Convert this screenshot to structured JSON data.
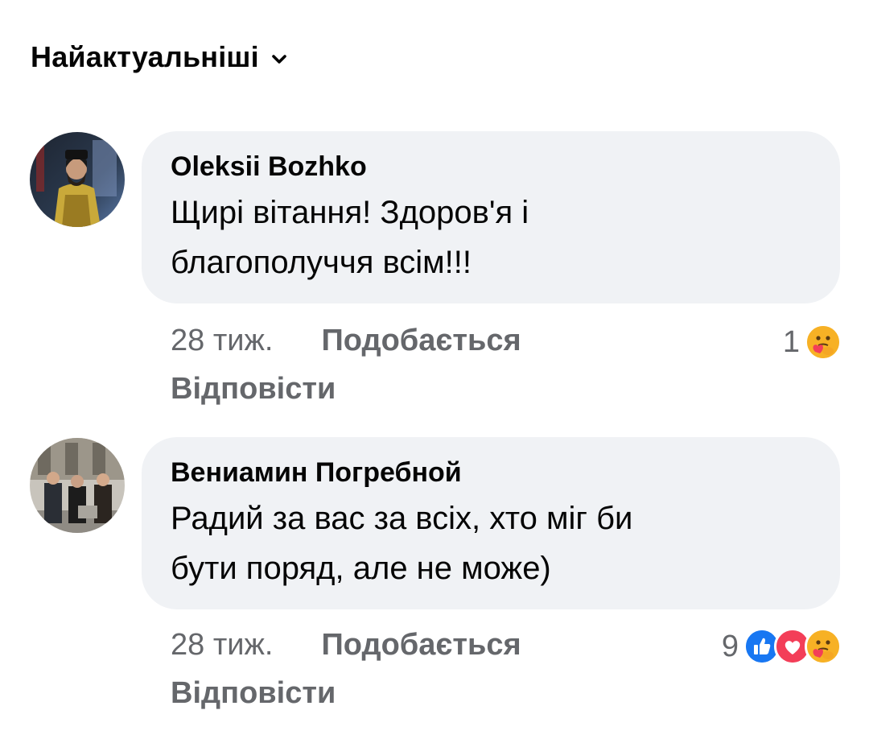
{
  "sort": {
    "label": "Найактуальніші",
    "icon": "chevron-down-icon"
  },
  "comments": [
    {
      "author": "Oleksii Bozhko",
      "text_line1": "Щирі вітання! Здоров'я і",
      "text_line2": "благополуччя всім!!!",
      "time": "28 тиж.",
      "like_label": "Подобається",
      "reply_label": "Відповісти",
      "reaction_count": "1",
      "reactions": [
        "care-icon"
      ]
    },
    {
      "author": "Вениамин Погребной",
      "text_line1": "Радий за вас за всіх, хто міг би",
      "text_line2": "бути поряд, але не може)",
      "time": "28 тиж.",
      "like_label": "Подобається",
      "reply_label": "Відповісти",
      "reaction_count": "9",
      "reactions": [
        "like-icon",
        "love-icon",
        "care-icon"
      ]
    }
  ],
  "colors": {
    "bubble": "#f0f2f5",
    "meta_text": "#65676b",
    "primary_text": "#050505",
    "like_blue": "#1877f2",
    "love_red": "#f33e58",
    "care_yellow": "#f7b125"
  }
}
